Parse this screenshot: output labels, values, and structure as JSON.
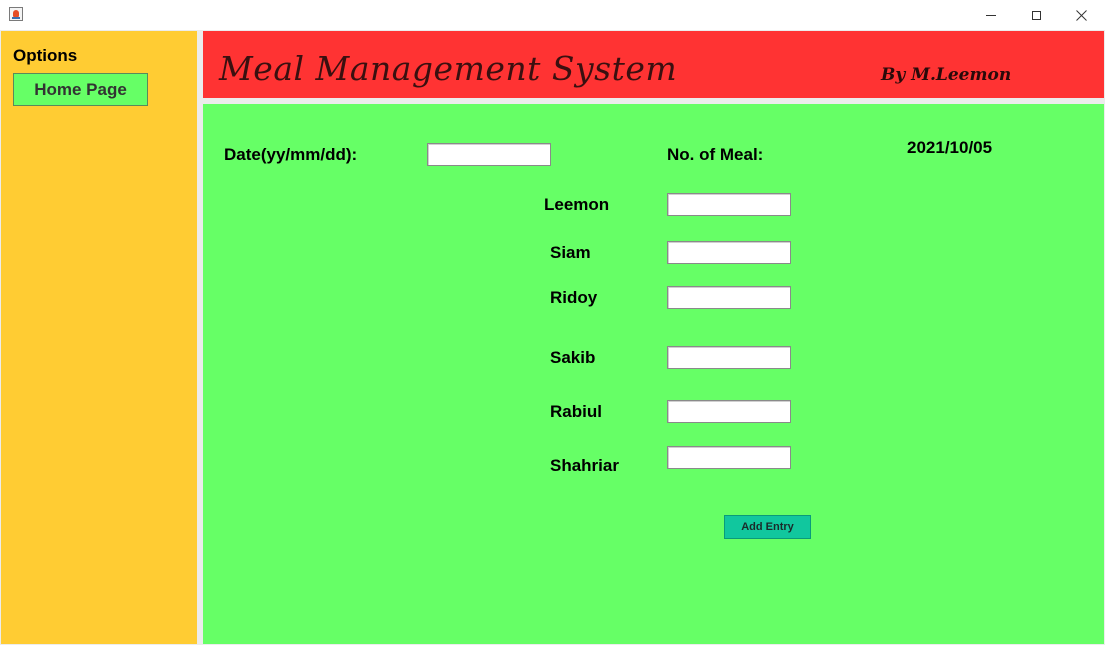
{
  "window": {
    "title": ""
  },
  "sidebar": {
    "title": "Options",
    "home_button": "Home Page"
  },
  "header": {
    "title": "Meal Management System",
    "author": "By M.Leemon"
  },
  "form": {
    "date_label": "Date(yy/mm/dd):",
    "date_value": "",
    "meal_label": "No. of Meal:",
    "current_date": "2021/10/05",
    "members": [
      {
        "name": "Leemon",
        "value": ""
      },
      {
        "name": "Siam",
        "value": ""
      },
      {
        "name": "Ridoy",
        "value": ""
      },
      {
        "name": "Sakib",
        "value": ""
      },
      {
        "name": "Rabiul",
        "value": ""
      },
      {
        "name": "Shahriar",
        "value": ""
      }
    ],
    "add_button": "Add Entry"
  },
  "colors": {
    "sidebar_bg": "#ffcc33",
    "header_bg": "#ff3333",
    "main_bg": "#66ff66",
    "home_button_bg": "#66ff66",
    "add_button_bg": "#11c79e"
  },
  "icons": {
    "app": "java-cup-icon",
    "minimize": "minimize-icon",
    "maximize": "maximize-icon",
    "close": "close-icon"
  }
}
